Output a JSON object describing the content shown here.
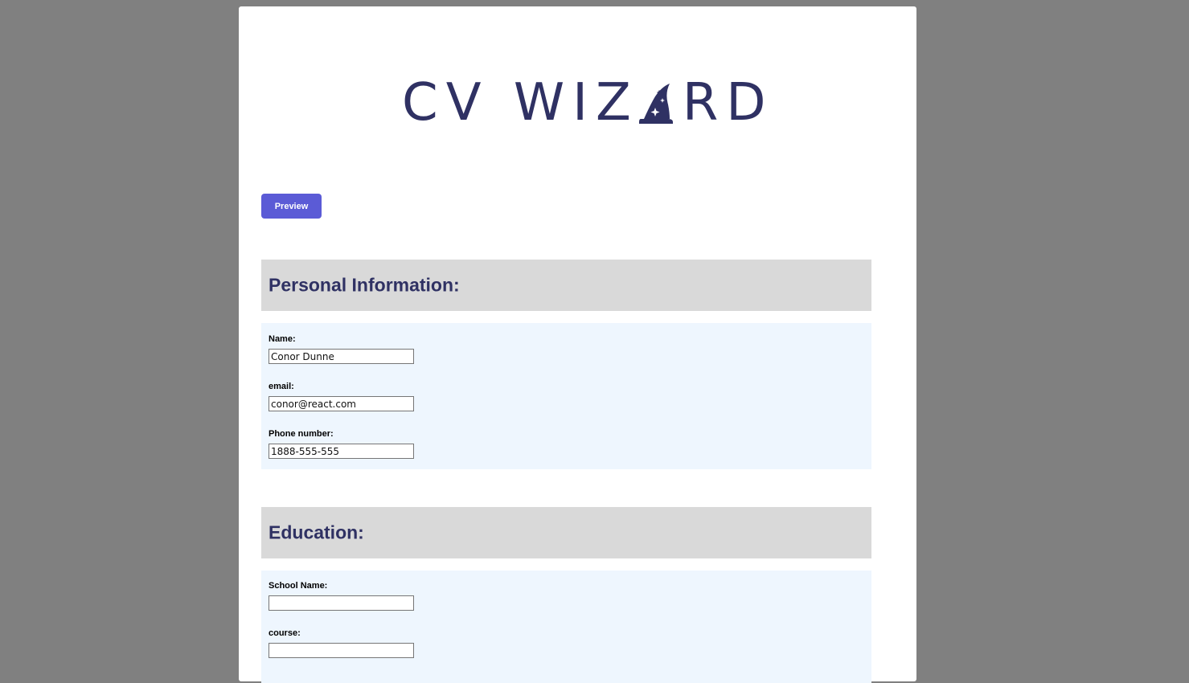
{
  "logo": {
    "text_left": "CV WIZ",
    "text_right": "RD",
    "hat_icon": "wizard-hat-icon",
    "color": "#2f3163"
  },
  "toolbar": {
    "preview_label": "Preview",
    "accent": "#5b5bd6"
  },
  "personal": {
    "title": "Personal Information:",
    "fields": [
      {
        "label": "Name:",
        "value": "Conor Dunne"
      },
      {
        "label": "email:",
        "value": "conor@react.com"
      },
      {
        "label": "Phone number:",
        "value": "1888-555-555"
      }
    ]
  },
  "education": {
    "title": "Education:",
    "fields": [
      {
        "label": "School Name:",
        "value": ""
      },
      {
        "label": "course:",
        "value": ""
      }
    ]
  }
}
